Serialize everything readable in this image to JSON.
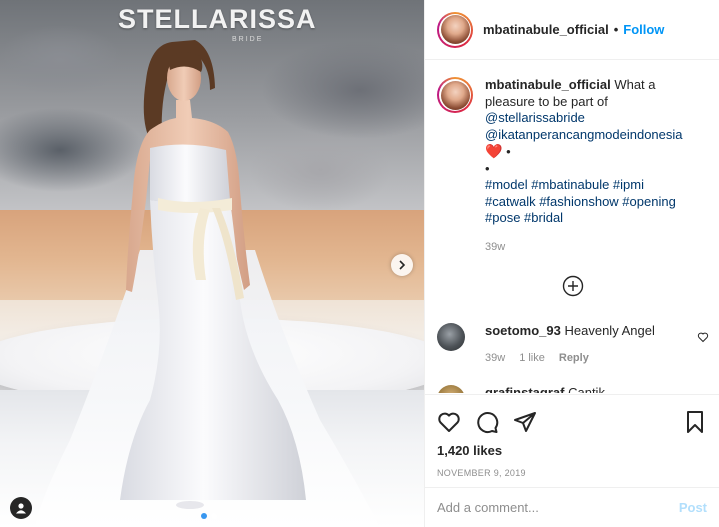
{
  "media": {
    "brand_text": "STELLARISSA",
    "brand_sub": "BRIDE",
    "carousel": {
      "count": 2,
      "active": 1
    }
  },
  "header": {
    "username": "mbatinabule_official",
    "separator": "•",
    "follow_label": "Follow"
  },
  "caption": {
    "username": "mbatinabule_official",
    "text": "What a pleasure to be part of",
    "mention1": "@stellarissabride",
    "mention2": "@ikatanperancangmodeindonesia",
    "emoji": "❤️",
    "bullet1": "•",
    "bullet2": "•",
    "hashtags_line1": "#model #mbatinabule #ipmi",
    "hashtags_line2": "#catwalk #fashionshow #opening",
    "hashtags_line3": "#pose #bridal",
    "time": "39w"
  },
  "comments": [
    {
      "username": "soetomo_93",
      "text": "Heavenly Angel",
      "time": "39w",
      "likes": "1 like",
      "reply": "Reply"
    },
    {
      "username": "grafinstagraf",
      "text": "Cantik",
      "time": "",
      "likes": "",
      "reply": ""
    }
  ],
  "actions": {
    "likes": "1,420 likes",
    "date": "NOVEMBER 9, 2019"
  },
  "add_comment": {
    "placeholder": "Add a comment...",
    "post_label": "Post"
  },
  "colors": {
    "follow": "#0095f6",
    "link": "#00376b",
    "muted": "#8e8e8e",
    "post_disabled": "#b2dffc"
  }
}
